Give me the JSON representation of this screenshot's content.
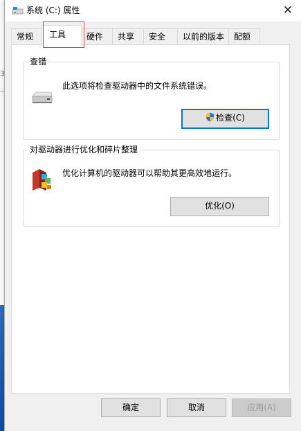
{
  "window": {
    "title": "系统 (C:) 属性",
    "close_glyph": "✕"
  },
  "tabs": [
    {
      "label": "常规"
    },
    {
      "label": "工具"
    },
    {
      "label": "硬件"
    },
    {
      "label": "共享"
    },
    {
      "label": "安全"
    },
    {
      "label": "以前的版本"
    },
    {
      "label": "配额"
    }
  ],
  "active_tab": "工具",
  "error_check": {
    "title": "查错",
    "description": "此选项将检查驱动器中的文件系统错误。",
    "button_label": "检查(C)"
  },
  "optimize": {
    "title": "对驱动器进行优化和碎片整理",
    "description": "优化计算机的驱动器可以帮助其更高效地运行。",
    "button_label": "优化(O)"
  },
  "footer": {
    "ok_label": "确定",
    "cancel_label": "取消",
    "apply_label": "应用(A)"
  },
  "background": {
    "left_mark": "3"
  },
  "colors": {
    "highlight_border": "#e53935",
    "default_button_border": "#0078d7",
    "taskbar_blue": "#0b4fb4"
  }
}
